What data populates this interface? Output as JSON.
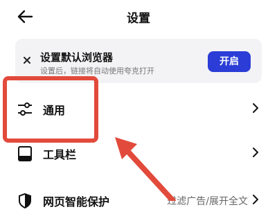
{
  "header": {
    "title": "设置"
  },
  "banner": {
    "title": "设置默认浏览器",
    "description": "设置后，链接将自动使用夸克打开",
    "button_label": "开启"
  },
  "settings": {
    "items": [
      {
        "label": "通用",
        "icon": "sliders-icon",
        "sub": ""
      },
      {
        "label": "工具栏",
        "icon": "toolbar-icon",
        "sub": ""
      },
      {
        "label": "网页智能保护",
        "icon": "shield-icon",
        "sub": "过滤广告/展开全文"
      }
    ]
  },
  "colors": {
    "accent": "#2b3dd6",
    "highlight": "#e24a3b",
    "banner_bg": "#f3f3f5"
  }
}
